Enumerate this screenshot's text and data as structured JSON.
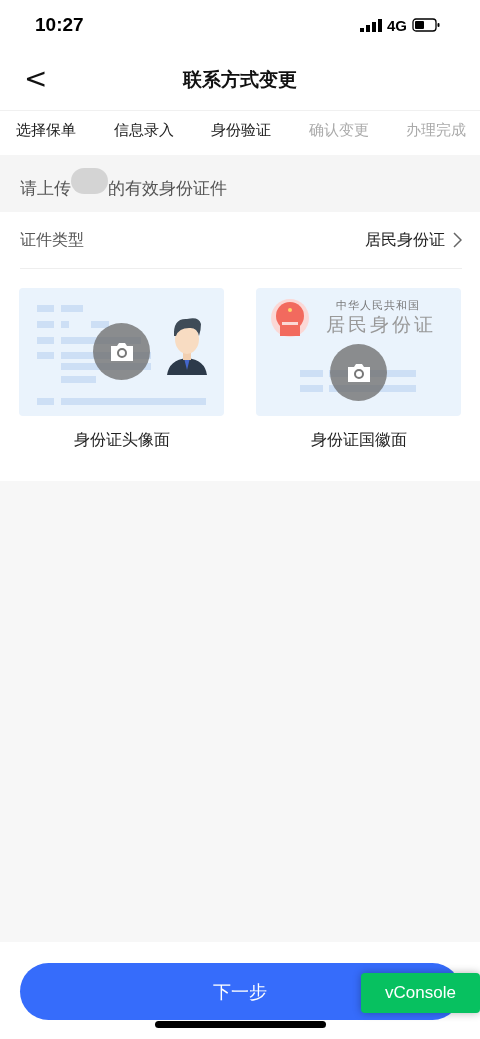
{
  "status_bar": {
    "time": "10:27",
    "network": "4G"
  },
  "nav": {
    "back": "<",
    "title": "联系方式变更"
  },
  "steps": [
    {
      "label": "选择保单",
      "completed": true
    },
    {
      "label": "信息录入",
      "completed": true
    },
    {
      "label": "身份验证",
      "completed": true
    },
    {
      "label": "确认变更",
      "completed": false
    },
    {
      "label": "办理完成",
      "completed": false
    }
  ],
  "prompt": {
    "before": "请上传",
    "after": "的有效身份证件"
  },
  "id_type": {
    "label": "证件类型",
    "value": "居民身份证"
  },
  "cards": [
    {
      "kind": "front",
      "caption": "身份证头像面"
    },
    {
      "kind": "back",
      "country": "中华人民共和国",
      "card_title": "居民身份证",
      "caption": "身份证国徽面"
    }
  ],
  "next_button": "下一步",
  "vconsole": "vConsole"
}
